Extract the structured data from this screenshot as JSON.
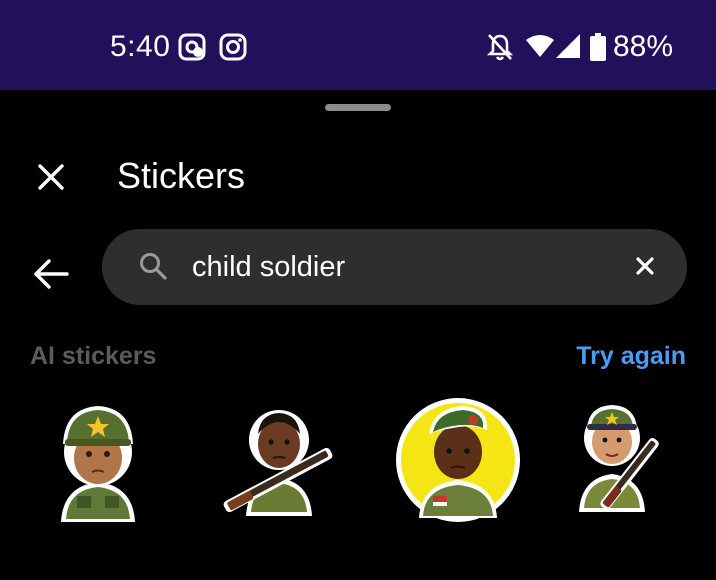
{
  "status_bar": {
    "time": "5:40",
    "battery": "88%",
    "left_icons": [
      "messenger-icon",
      "instagram-icon"
    ],
    "right_icons": [
      "bell-off-icon",
      "wifi-icon",
      "signal-icon",
      "battery-icon"
    ],
    "background": "#21105a"
  },
  "header": {
    "title": "Stickers"
  },
  "search": {
    "query": "child soldier"
  },
  "section": {
    "label": "AI stickers",
    "action": "Try again",
    "action_color": "#4a9cf5"
  },
  "stickers": [
    {
      "subject": "child in green helmet and uniform"
    },
    {
      "subject": "child holding rifle"
    },
    {
      "subject": "child in green beret on yellow circle"
    },
    {
      "subject": "child in cap holding rifle"
    }
  ]
}
